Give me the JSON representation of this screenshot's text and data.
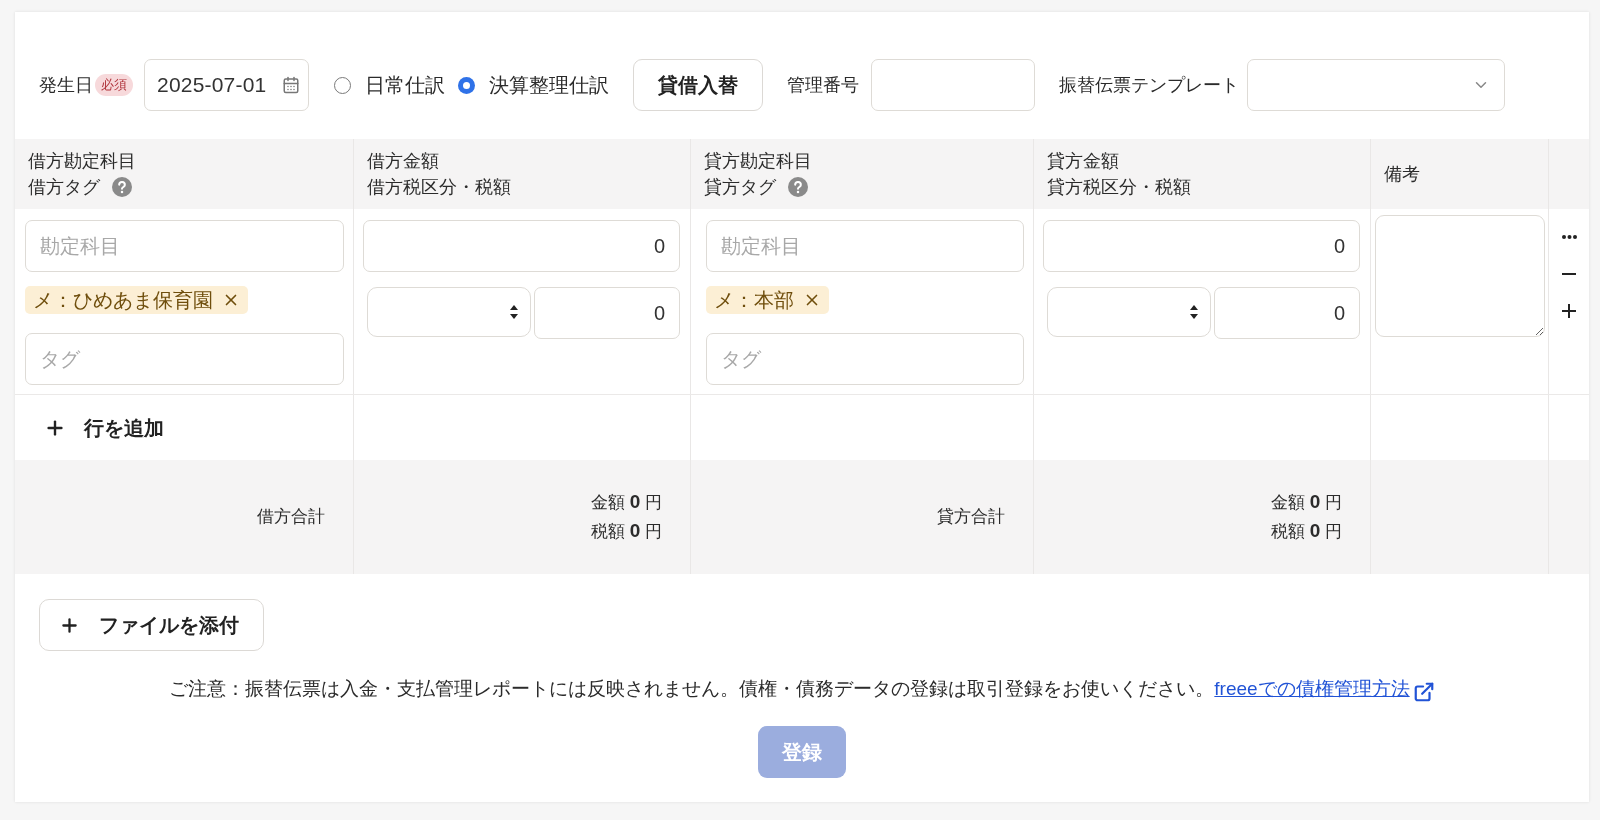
{
  "form": {
    "date": {
      "label": "発生日",
      "badge": "必須",
      "value": "2025-07-01"
    },
    "entry_types": [
      {
        "label": "日常仕訳",
        "selected": false
      },
      {
        "label": "決算整理仕訳",
        "selected": true
      }
    ],
    "swap_button": "貸借入替",
    "control_number": {
      "label": "管理番号"
    },
    "template": {
      "label": "振替伝票テンプレート"
    }
  },
  "table": {
    "columns": [
      {
        "lines": [
          "借方勘定科目",
          "借方タグ"
        ],
        "help": true
      },
      {
        "lines": [
          "借方金額",
          "借方税区分・税額"
        ]
      },
      {
        "lines": [
          "貸方勘定科目",
          "貸方タグ"
        ],
        "help": true
      },
      {
        "lines": [
          "貸方金額",
          "貸方税区分・税額"
        ]
      },
      {
        "lines": [
          "備考"
        ]
      }
    ],
    "rows": [
      {
        "sides": [
          {
            "account": {
              "placeholder": "勘定科目"
            },
            "tags": [
              "メ：ひめあま保育園"
            ],
            "tag_input": {
              "placeholder": "タグ"
            },
            "amount": "0",
            "tax_amount": "0"
          },
          {
            "account": {
              "placeholder": "勘定科目"
            },
            "tags": [
              "メ：本部"
            ],
            "tag_input": {
              "placeholder": "タグ"
            },
            "amount": "0",
            "tax_amount": "0"
          }
        ]
      }
    ],
    "add_row_button": "行を追加",
    "totals": [
      {
        "label": "借方合計",
        "lines": [
          "金額 **0** 円",
          "税額 **0** 円"
        ]
      },
      {
        "label": "貸方合計",
        "lines": [
          "金額 **0** 円",
          "税額 **0** 円"
        ]
      }
    ]
  },
  "attach_button": "ファイルを添付",
  "notice": {
    "text": "ご注意：振替伝票は入金・支払管理レポートには反映されません。債権・債務データの登録は取引登録をお使いください。",
    "link": "freeeでの債権管理方法"
  },
  "submit_button": {
    "label": "登録",
    "disabled": true
  }
}
